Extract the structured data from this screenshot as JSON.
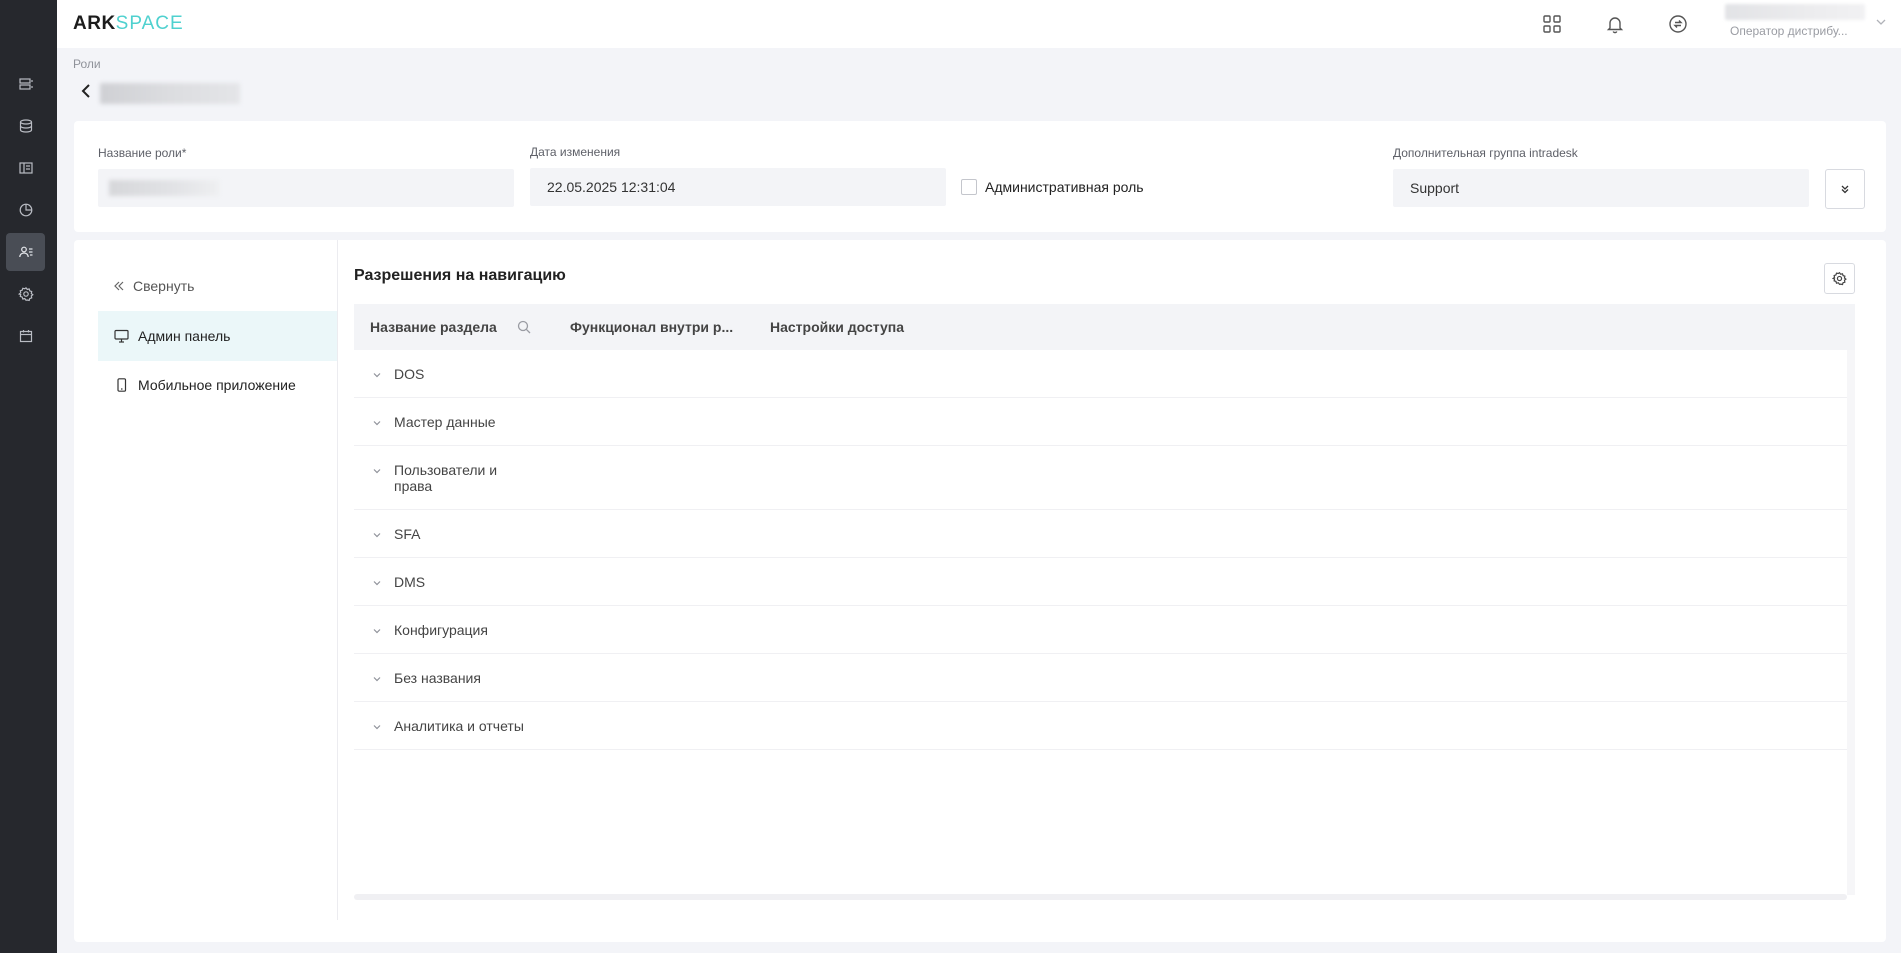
{
  "app": {
    "logo_main": "ARK",
    "logo_accent": "SPACE"
  },
  "user": {
    "role": "Оператор дистрибу..."
  },
  "breadcrumb": "Роли",
  "form": {
    "role_name_label": "Название роли*",
    "date_label": "Дата изменения",
    "date_value": "22.05.2025 12:31:04",
    "admin_role_label": "Административная роль",
    "group_label": "Дополнительная группа intradesk",
    "group_value": "Support"
  },
  "left_menu": {
    "collapse_label": "Свернуть",
    "items": [
      {
        "label": "Админ панель",
        "icon": "monitor-icon",
        "active": true
      },
      {
        "label": "Мобильное приложение",
        "icon": "mobile-icon",
        "active": false
      }
    ]
  },
  "permissions": {
    "title": "Разрешения на навигацию",
    "columns": [
      "Название раздела",
      "Функционал внутри р...",
      "Настройки доступа"
    ],
    "rows": [
      {
        "label": "DOS"
      },
      {
        "label": "Мастер данные"
      },
      {
        "label": "Пользователи и права"
      },
      {
        "label": "SFA"
      },
      {
        "label": "DMS"
      },
      {
        "label": "Конфигурация"
      },
      {
        "label": "Без названия"
      },
      {
        "label": "Аналитика и отчеты"
      }
    ]
  },
  "colors": {
    "sidebar_bg": "#26282d",
    "accent": "#4fd1cf",
    "active_menu_bg": "#ebf7f9"
  }
}
